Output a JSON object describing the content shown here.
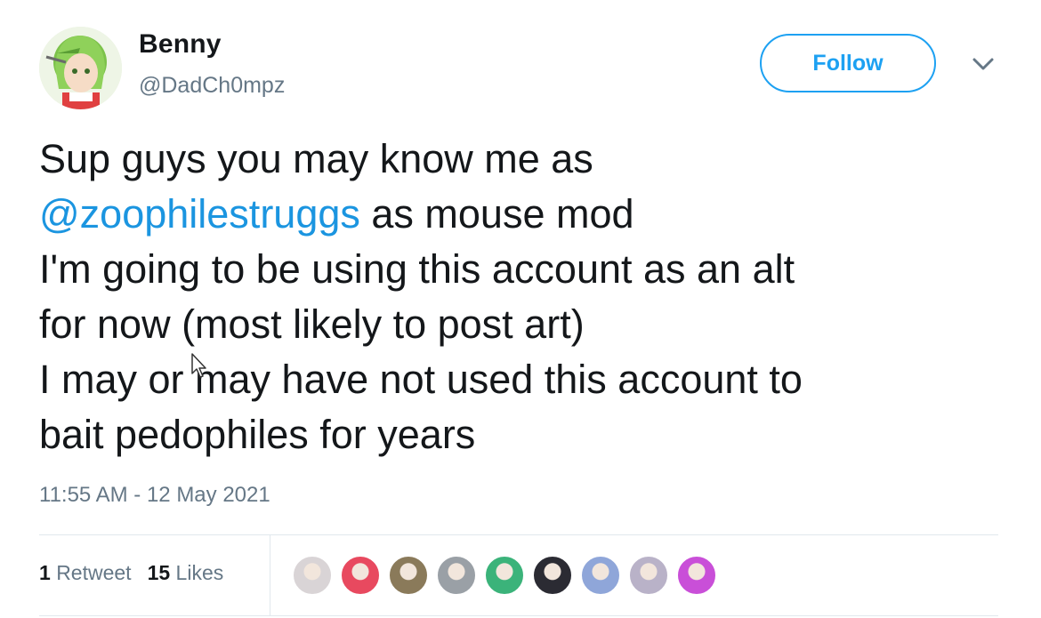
{
  "user": {
    "name": "Benny",
    "handle": "@DadCh0mpz"
  },
  "actions": {
    "follow_label": "Follow"
  },
  "icons": {
    "more": "chevron-down-icon",
    "cursor": "cursor-icon"
  },
  "tweet": {
    "line1": "Sup guys you may know me as",
    "mention": "@zoophilestruggs",
    "line2_rest": " as mouse mod",
    "line3": "I'm going to be using this account as an alt",
    "line4": "for now (most likely to post art)",
    "line5": "I may or may have not used this account to",
    "line6": "bait pedophiles for years",
    "timestamp": "11:55 AM - 12 May 2021"
  },
  "stats": {
    "retweet_count": "1",
    "retweet_label": "Retweet",
    "likes_count": "15",
    "likes_label": "Likes"
  },
  "colors": {
    "accent": "#1da1f2",
    "mention": "#1b95e0",
    "secondary_text": "#657786",
    "primary_text": "#14171a"
  },
  "likers": [
    {
      "name": "liker-avatar-1",
      "color": "#d9d4d6"
    },
    {
      "name": "liker-avatar-2",
      "color": "#e8495f"
    },
    {
      "name": "liker-avatar-3",
      "color": "#8a7a5a"
    },
    {
      "name": "liker-avatar-4",
      "color": "#9aa0a6"
    },
    {
      "name": "liker-avatar-5",
      "color": "#3bb37a"
    },
    {
      "name": "liker-avatar-6",
      "color": "#2b2b33"
    },
    {
      "name": "liker-avatar-7",
      "color": "#8fa6d9"
    },
    {
      "name": "liker-avatar-8",
      "color": "#b9b2c8"
    },
    {
      "name": "liker-avatar-9",
      "color": "#c94fd8"
    }
  ]
}
